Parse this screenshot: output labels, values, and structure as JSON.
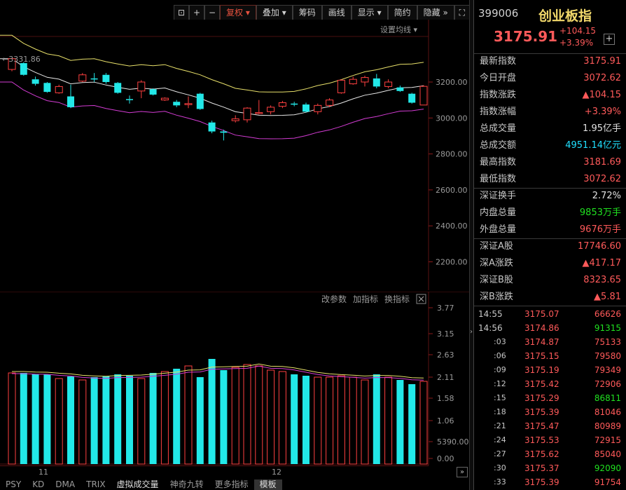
{
  "toolbar": {
    "buttons": [
      "复权",
      "叠加",
      "筹码",
      "画线",
      "显示",
      "简约",
      "隐藏"
    ],
    "active": "复权"
  },
  "main_chart": {
    "settings_label": "设置均线",
    "high_label": "3331.86",
    "y_ticks": [
      "3200.00",
      "3000.00",
      "2800.00",
      "2600.00",
      "2400.00",
      "2200.00"
    ],
    "candles": [
      {
        "o": 3270,
        "c": 3330,
        "h": 3332,
        "l": 3260
      },
      {
        "o": 3305,
        "c": 3240,
        "h": 3310,
        "l": 3235
      },
      {
        "o": 3215,
        "c": 3190,
        "h": 3230,
        "l": 3180
      },
      {
        "o": 3195,
        "c": 3145,
        "h": 3200,
        "l": 3140
      },
      {
        "o": 3140,
        "c": 3175,
        "h": 3185,
        "l": 3135
      },
      {
        "o": 3120,
        "c": 3060,
        "h": 3185,
        "l": 3055
      },
      {
        "o": 3205,
        "c": 3240,
        "h": 3250,
        "l": 3200
      },
      {
        "o": 3220,
        "c": 3215,
        "h": 3250,
        "l": 3200
      },
      {
        "o": 3240,
        "c": 3200,
        "h": 3250,
        "l": 3190
      },
      {
        "o": 3195,
        "c": 3140,
        "h": 3200,
        "l": 3135
      },
      {
        "o": 3105,
        "c": 3100,
        "h": 3125,
        "l": 3080
      },
      {
        "o": 3150,
        "c": 3200,
        "h": 3210,
        "l": 3110
      },
      {
        "o": 3160,
        "c": 3130,
        "h": 3165,
        "l": 3125
      },
      {
        "o": 3100,
        "c": 3110,
        "h": 3115,
        "l": 3095
      },
      {
        "o": 3090,
        "c": 3070,
        "h": 3100,
        "l": 3060
      },
      {
        "o": 3075,
        "c": 3080,
        "h": 3120,
        "l": 3055
      },
      {
        "o": 3135,
        "c": 3050,
        "h": 3140,
        "l": 3045
      },
      {
        "o": 2975,
        "c": 2925,
        "h": 2985,
        "l": 2915
      },
      {
        "o": 2925,
        "c": 2918,
        "h": 2935,
        "l": 2875
      },
      {
        "o": 2985,
        "c": 2995,
        "h": 3015,
        "l": 2975
      },
      {
        "o": 2990,
        "c": 3055,
        "h": 3060,
        "l": 2975
      },
      {
        "o": 3025,
        "c": 3030,
        "h": 3100,
        "l": 3020
      },
      {
        "o": 3035,
        "c": 3060,
        "h": 3070,
        "l": 3020
      },
      {
        "o": 3065,
        "c": 3085,
        "h": 3095,
        "l": 3055
      },
      {
        "o": 3080,
        "c": 3075,
        "h": 3090,
        "l": 3065
      },
      {
        "o": 3075,
        "c": 3035,
        "h": 3085,
        "l": 3030
      },
      {
        "o": 3035,
        "c": 3070,
        "h": 3080,
        "l": 3020
      },
      {
        "o": 3070,
        "c": 3100,
        "h": 3110,
        "l": 3060
      },
      {
        "o": 3140,
        "c": 3210,
        "h": 3215,
        "l": 3135
      },
      {
        "o": 3190,
        "c": 3215,
        "h": 3230,
        "l": 3185
      },
      {
        "o": 3200,
        "c": 3225,
        "h": 3235,
        "l": 3175
      },
      {
        "o": 3220,
        "c": 3175,
        "h": 3245,
        "l": 3165
      },
      {
        "o": 3175,
        "c": 3200,
        "h": 3215,
        "l": 3165
      },
      {
        "o": 3170,
        "c": 3150,
        "h": 3180,
        "l": 3145
      },
      {
        "o": 3135,
        "c": 3085,
        "h": 3140,
        "l": 3080
      },
      {
        "o": 3072,
        "c": 3176,
        "h": 3182,
        "l": 3072
      }
    ]
  },
  "vol_chart": {
    "buttons": [
      "改参数",
      "加指标",
      "换指标"
    ],
    "y_ticks": [
      "3.77",
      "3.15",
      "2.63",
      "2.11",
      "1.58",
      "1.06",
      "5390.00",
      "0.00"
    ],
    "x_labels": [
      "11",
      "12"
    ]
  },
  "bottom_tabs": [
    "PSY",
    "KD",
    "DMA",
    "TRIX",
    "虚拟成交量",
    "神奇九转",
    "更多指标",
    "模板"
  ],
  "right_panel": {
    "code": "399006",
    "name": "创业板指",
    "price": "3175.91",
    "change": "+104.15",
    "change_pct": "+3.39%",
    "stats": [
      {
        "k": "最新指数",
        "v": "3175.91",
        "color": "#ff5a5a"
      },
      {
        "k": "今日开盘",
        "v": "3072.62",
        "color": "#ff5a5a"
      },
      {
        "k": "指数涨跌",
        "v": "▲104.15",
        "color": "#ff5a5a"
      },
      {
        "k": "指数涨幅",
        "v": "+3.39%",
        "color": "#ff5a5a"
      },
      {
        "k": "总成交量",
        "v": "1.95亿手",
        "color": "#e0e0e0"
      },
      {
        "k": "总成交额",
        "v": "4951.14亿元",
        "color": "#20e0ff"
      },
      {
        "k": "最高指数",
        "v": "3181.69",
        "color": "#ff5a5a"
      },
      {
        "k": "最低指数",
        "v": "3072.62",
        "color": "#ff5a5a"
      },
      {
        "k": "深证换手",
        "v": "2.72%",
        "color": "#e0e0e0"
      },
      {
        "k": "内盘总量",
        "v": "9853万手",
        "color": "#20e020"
      },
      {
        "k": "外盘总量",
        "v": "9676万手",
        "color": "#ff5a5a"
      },
      {
        "k": "深证A股",
        "v": "17746.60",
        "color": "#ff5a5a"
      },
      {
        "k": "深A涨跌",
        "v": "▲417.17",
        "color": "#ff5a5a"
      },
      {
        "k": "深证B股",
        "v": "8323.65",
        "color": "#ff5a5a"
      },
      {
        "k": "深B涨跌",
        "v": "▲5.81",
        "color": "#ff5a5a"
      }
    ],
    "ticks": [
      {
        "t": "14:55",
        "p": "3175.07",
        "q": "66626",
        "qc": "#ff5a5a"
      },
      {
        "t": "14:56",
        "p": "3174.86",
        "q": "91315",
        "qc": "#20e020"
      },
      {
        "t": ":03",
        "p": "3174.87",
        "q": "75133",
        "qc": "#ff5a5a"
      },
      {
        "t": ":06",
        "p": "3175.15",
        "q": "79580",
        "qc": "#ff5a5a"
      },
      {
        "t": ":09",
        "p": "3175.19",
        "q": "79349",
        "qc": "#ff5a5a"
      },
      {
        "t": ":12",
        "p": "3175.42",
        "q": "72906",
        "qc": "#ff5a5a"
      },
      {
        "t": ":15",
        "p": "3175.29",
        "q": "86811",
        "qc": "#20e020"
      },
      {
        "t": ":18",
        "p": "3175.39",
        "q": "81046",
        "qc": "#ff5a5a"
      },
      {
        "t": ":21",
        "p": "3175.47",
        "q": "80989",
        "qc": "#ff5a5a"
      },
      {
        "t": ":24",
        "p": "3175.53",
        "q": "72915",
        "qc": "#ff5a5a"
      },
      {
        "t": ":27",
        "p": "3175.62",
        "q": "85040",
        "qc": "#ff5a5a"
      },
      {
        "t": ":30",
        "p": "3175.37",
        "q": "92090",
        "qc": "#20e020"
      },
      {
        "t": ":33",
        "p": "3175.39",
        "q": "91754",
        "qc": "#ff5a5a"
      }
    ]
  }
}
